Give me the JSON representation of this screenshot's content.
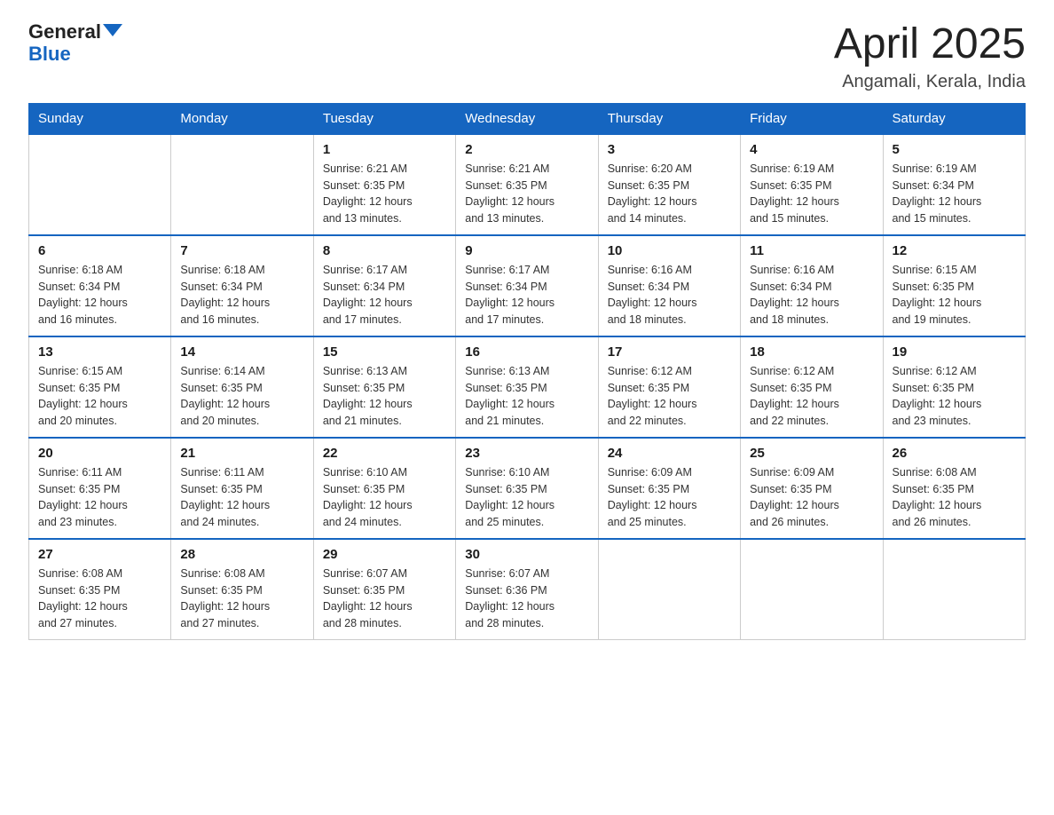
{
  "header": {
    "logo_general": "General",
    "logo_blue": "Blue",
    "title": "April 2025",
    "subtitle": "Angamali, Kerala, India"
  },
  "weekdays": [
    "Sunday",
    "Monday",
    "Tuesday",
    "Wednesday",
    "Thursday",
    "Friday",
    "Saturday"
  ],
  "weeks": [
    [
      {
        "day": "",
        "info": ""
      },
      {
        "day": "",
        "info": ""
      },
      {
        "day": "1",
        "info": "Sunrise: 6:21 AM\nSunset: 6:35 PM\nDaylight: 12 hours\nand 13 minutes."
      },
      {
        "day": "2",
        "info": "Sunrise: 6:21 AM\nSunset: 6:35 PM\nDaylight: 12 hours\nand 13 minutes."
      },
      {
        "day": "3",
        "info": "Sunrise: 6:20 AM\nSunset: 6:35 PM\nDaylight: 12 hours\nand 14 minutes."
      },
      {
        "day": "4",
        "info": "Sunrise: 6:19 AM\nSunset: 6:35 PM\nDaylight: 12 hours\nand 15 minutes."
      },
      {
        "day": "5",
        "info": "Sunrise: 6:19 AM\nSunset: 6:34 PM\nDaylight: 12 hours\nand 15 minutes."
      }
    ],
    [
      {
        "day": "6",
        "info": "Sunrise: 6:18 AM\nSunset: 6:34 PM\nDaylight: 12 hours\nand 16 minutes."
      },
      {
        "day": "7",
        "info": "Sunrise: 6:18 AM\nSunset: 6:34 PM\nDaylight: 12 hours\nand 16 minutes."
      },
      {
        "day": "8",
        "info": "Sunrise: 6:17 AM\nSunset: 6:34 PM\nDaylight: 12 hours\nand 17 minutes."
      },
      {
        "day": "9",
        "info": "Sunrise: 6:17 AM\nSunset: 6:34 PM\nDaylight: 12 hours\nand 17 minutes."
      },
      {
        "day": "10",
        "info": "Sunrise: 6:16 AM\nSunset: 6:34 PM\nDaylight: 12 hours\nand 18 minutes."
      },
      {
        "day": "11",
        "info": "Sunrise: 6:16 AM\nSunset: 6:34 PM\nDaylight: 12 hours\nand 18 minutes."
      },
      {
        "day": "12",
        "info": "Sunrise: 6:15 AM\nSunset: 6:35 PM\nDaylight: 12 hours\nand 19 minutes."
      }
    ],
    [
      {
        "day": "13",
        "info": "Sunrise: 6:15 AM\nSunset: 6:35 PM\nDaylight: 12 hours\nand 20 minutes."
      },
      {
        "day": "14",
        "info": "Sunrise: 6:14 AM\nSunset: 6:35 PM\nDaylight: 12 hours\nand 20 minutes."
      },
      {
        "day": "15",
        "info": "Sunrise: 6:13 AM\nSunset: 6:35 PM\nDaylight: 12 hours\nand 21 minutes."
      },
      {
        "day": "16",
        "info": "Sunrise: 6:13 AM\nSunset: 6:35 PM\nDaylight: 12 hours\nand 21 minutes."
      },
      {
        "day": "17",
        "info": "Sunrise: 6:12 AM\nSunset: 6:35 PM\nDaylight: 12 hours\nand 22 minutes."
      },
      {
        "day": "18",
        "info": "Sunrise: 6:12 AM\nSunset: 6:35 PM\nDaylight: 12 hours\nand 22 minutes."
      },
      {
        "day": "19",
        "info": "Sunrise: 6:12 AM\nSunset: 6:35 PM\nDaylight: 12 hours\nand 23 minutes."
      }
    ],
    [
      {
        "day": "20",
        "info": "Sunrise: 6:11 AM\nSunset: 6:35 PM\nDaylight: 12 hours\nand 23 minutes."
      },
      {
        "day": "21",
        "info": "Sunrise: 6:11 AM\nSunset: 6:35 PM\nDaylight: 12 hours\nand 24 minutes."
      },
      {
        "day": "22",
        "info": "Sunrise: 6:10 AM\nSunset: 6:35 PM\nDaylight: 12 hours\nand 24 minutes."
      },
      {
        "day": "23",
        "info": "Sunrise: 6:10 AM\nSunset: 6:35 PM\nDaylight: 12 hours\nand 25 minutes."
      },
      {
        "day": "24",
        "info": "Sunrise: 6:09 AM\nSunset: 6:35 PM\nDaylight: 12 hours\nand 25 minutes."
      },
      {
        "day": "25",
        "info": "Sunrise: 6:09 AM\nSunset: 6:35 PM\nDaylight: 12 hours\nand 26 minutes."
      },
      {
        "day": "26",
        "info": "Sunrise: 6:08 AM\nSunset: 6:35 PM\nDaylight: 12 hours\nand 26 minutes."
      }
    ],
    [
      {
        "day": "27",
        "info": "Sunrise: 6:08 AM\nSunset: 6:35 PM\nDaylight: 12 hours\nand 27 minutes."
      },
      {
        "day": "28",
        "info": "Sunrise: 6:08 AM\nSunset: 6:35 PM\nDaylight: 12 hours\nand 27 minutes."
      },
      {
        "day": "29",
        "info": "Sunrise: 6:07 AM\nSunset: 6:35 PM\nDaylight: 12 hours\nand 28 minutes."
      },
      {
        "day": "30",
        "info": "Sunrise: 6:07 AM\nSunset: 6:36 PM\nDaylight: 12 hours\nand 28 minutes."
      },
      {
        "day": "",
        "info": ""
      },
      {
        "day": "",
        "info": ""
      },
      {
        "day": "",
        "info": ""
      }
    ]
  ]
}
